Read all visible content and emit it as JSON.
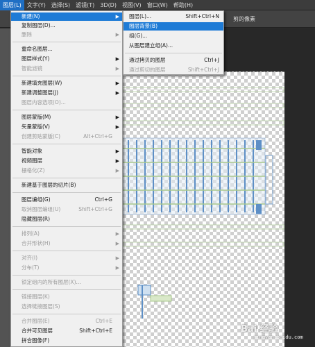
{
  "menubar": {
    "items": [
      "图层(L)",
      "文字(Y)",
      "选择(S)",
      "滤镜(T)",
      "3D(D)",
      "视图(V)",
      "窗口(W)",
      "帮助(H)"
    ]
  },
  "optionsbar": {
    "text": "剪的像素"
  },
  "main_menu": {
    "items": [
      {
        "label": "新建(N)",
        "shortcut": "",
        "submenu": true,
        "state": "highlight"
      },
      {
        "label": "复制图层(D)...",
        "shortcut": "",
        "submenu": false,
        "state": "normal"
      },
      {
        "label": "删除",
        "shortcut": "",
        "submenu": true,
        "state": "disabled"
      },
      {
        "label": "重命名图层...",
        "shortcut": "",
        "submenu": false,
        "state": "normal"
      },
      {
        "label": "图层样式(Y)",
        "shortcut": "",
        "submenu": true,
        "state": "normal"
      },
      {
        "label": "智能滤镜",
        "shortcut": "",
        "submenu": true,
        "state": "disabled"
      },
      {
        "label": "新建填充图层(W)",
        "shortcut": "",
        "submenu": true,
        "state": "normal"
      },
      {
        "label": "新建调整图层(J)",
        "shortcut": "",
        "submenu": true,
        "state": "normal"
      },
      {
        "label": "图层内容选项(O)...",
        "shortcut": "",
        "submenu": false,
        "state": "disabled"
      },
      {
        "label": "图层蒙版(M)",
        "shortcut": "",
        "submenu": true,
        "state": "normal"
      },
      {
        "label": "矢量蒙版(V)",
        "shortcut": "",
        "submenu": true,
        "state": "normal"
      },
      {
        "label": "创建剪贴蒙版(C)",
        "shortcut": "Alt+Ctrl+G",
        "submenu": false,
        "state": "disabled"
      },
      {
        "label": "智能对象",
        "shortcut": "",
        "submenu": true,
        "state": "normal"
      },
      {
        "label": "视频图层",
        "shortcut": "",
        "submenu": true,
        "state": "normal"
      },
      {
        "label": "栅格化(Z)",
        "shortcut": "",
        "submenu": true,
        "state": "disabled"
      },
      {
        "label": "新建基于图层的切片(B)",
        "shortcut": "",
        "submenu": false,
        "state": "normal"
      },
      {
        "label": "图层编组(G)",
        "shortcut": "Ctrl+G",
        "submenu": false,
        "state": "normal"
      },
      {
        "label": "取消图层编组(U)",
        "shortcut": "Shift+Ctrl+G",
        "submenu": false,
        "state": "disabled"
      },
      {
        "label": "隐藏图层(R)",
        "shortcut": "",
        "submenu": false,
        "state": "normal"
      },
      {
        "label": "排列(A)",
        "shortcut": "",
        "submenu": true,
        "state": "disabled"
      },
      {
        "label": "合并形状(H)",
        "shortcut": "",
        "submenu": true,
        "state": "disabled"
      },
      {
        "label": "对齐(I)",
        "shortcut": "",
        "submenu": true,
        "state": "disabled"
      },
      {
        "label": "分布(T)",
        "shortcut": "",
        "submenu": true,
        "state": "disabled"
      },
      {
        "label": "锁定组内的所有图层(X)...",
        "shortcut": "",
        "submenu": false,
        "state": "disabled"
      },
      {
        "label": "链接图层(K)",
        "shortcut": "",
        "submenu": false,
        "state": "disabled"
      },
      {
        "label": "选择链接图层(S)",
        "shortcut": "",
        "submenu": false,
        "state": "disabled"
      },
      {
        "label": "合并图层(E)",
        "shortcut": "Ctrl+E",
        "submenu": false,
        "state": "disabled"
      },
      {
        "label": "合并可见图层",
        "shortcut": "Shift+Ctrl+E",
        "submenu": false,
        "state": "normal"
      },
      {
        "label": "拼合图像(F)",
        "shortcut": "",
        "submenu": false,
        "state": "normal"
      },
      {
        "label": "修边",
        "shortcut": "",
        "submenu": true,
        "state": "normal"
      }
    ]
  },
  "sub_menu": {
    "items": [
      {
        "label": "图层(L)...",
        "shortcut": "Shift+Ctrl+N",
        "state": "normal"
      },
      {
        "label": "图层背景(B)",
        "shortcut": "",
        "state": "highlight"
      },
      {
        "label": "组(G)...",
        "shortcut": "",
        "state": "normal"
      },
      {
        "label": "从图层建立组(A)...",
        "shortcut": "",
        "state": "normal"
      },
      {
        "label": "通过拷贝的图层",
        "shortcut": "Ctrl+J",
        "state": "normal"
      },
      {
        "label": "通过剪切的图层",
        "shortcut": "Shift+Ctrl+J",
        "state": "disabled"
      }
    ]
  },
  "watermark": {
    "text": "Bai 经验",
    "sub": "jingyan.baidu.com"
  },
  "colors": {
    "highlight": "#1e7bd6",
    "menu_bg": "#f0f0f0",
    "disabled": "#9a9a9a"
  }
}
